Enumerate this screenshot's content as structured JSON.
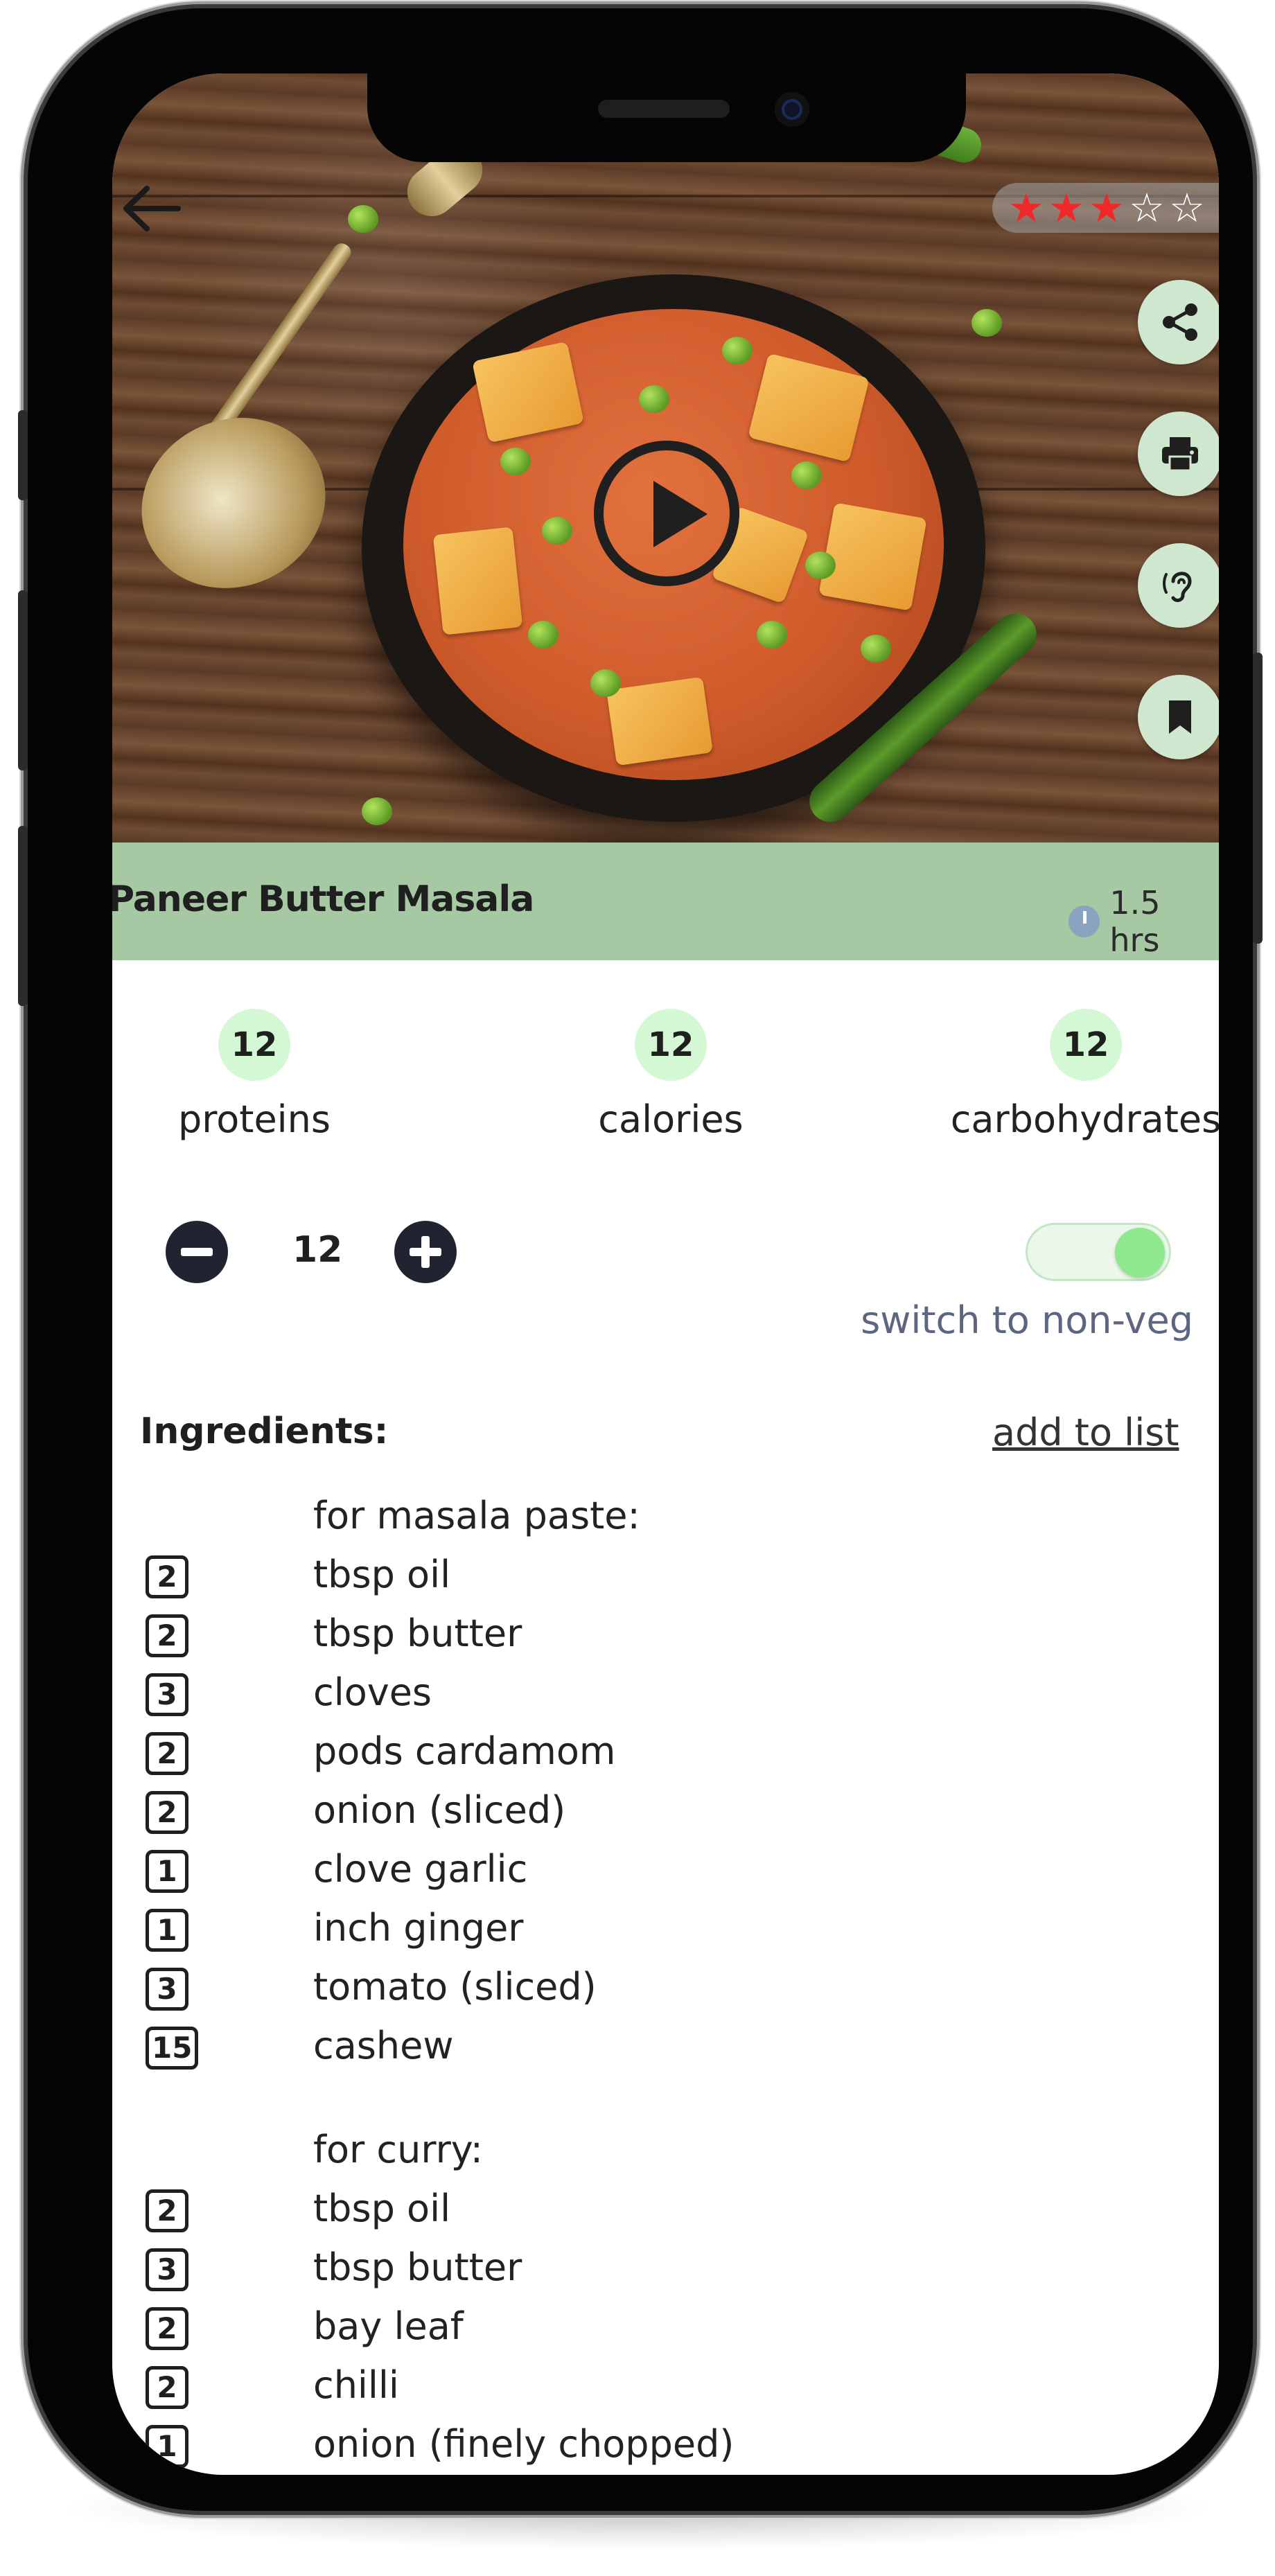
{
  "recipe": {
    "title": "Paneer Butter Masala",
    "time": "1.5 hrs",
    "rating": {
      "value": 3,
      "max": 5
    }
  },
  "icons": {
    "back": "arrow-left-icon",
    "actions": [
      "share-icon",
      "print-icon",
      "ear-listen-icon",
      "bookmark-icon"
    ],
    "play": "play-icon",
    "clock": "clock-icon"
  },
  "nutrition": [
    {
      "value": "12",
      "label": "proteins"
    },
    {
      "value": "12",
      "label": "calories"
    },
    {
      "value": "12",
      "label": "carbohydrates"
    }
  ],
  "servings": {
    "value": "12"
  },
  "veg_toggle": {
    "label": "switch to non-veg",
    "on": true
  },
  "ingredients": {
    "heading": "Ingredients:",
    "add_to_list": "add to list",
    "sections": [
      {
        "title": "for masala paste:",
        "items": [
          {
            "qty": "2",
            "name": "tbsp oil"
          },
          {
            "qty": "2",
            "name": "tbsp butter"
          },
          {
            "qty": "3",
            "name": "cloves"
          },
          {
            "qty": "2",
            "name": "pods cardamom"
          },
          {
            "qty": "2",
            "name": "onion (sliced)"
          },
          {
            "qty": "1",
            "name": "clove garlic"
          },
          {
            "qty": "1",
            "name": "inch ginger"
          },
          {
            "qty": "3",
            "name": "tomato (sliced)"
          },
          {
            "qty": "15",
            "name": "cashew"
          }
        ]
      },
      {
        "title": "for curry:",
        "items": [
          {
            "qty": "2",
            "name": "tbsp oil"
          },
          {
            "qty": "3",
            "name": "tbsp butter"
          },
          {
            "qty": "2",
            "name": "bay leaf"
          },
          {
            "qty": "2",
            "name": "chilli"
          },
          {
            "qty": "1",
            "name": "onion (finely chopped)"
          }
        ]
      }
    ]
  },
  "colors": {
    "accent_green": "#d4f7d4",
    "title_bar": "#a6c9a4",
    "star": "#ef2929",
    "dark": "#1f2430"
  }
}
